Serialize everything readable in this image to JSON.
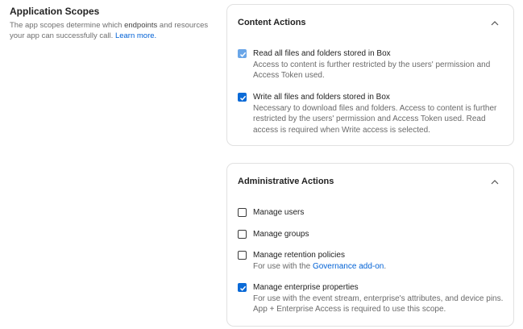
{
  "intro": {
    "title": "Application Scopes",
    "desc_part1": "The app scopes determine which",
    "desc_strong": "endpoints",
    "desc_part2": "and resources your app can successfully call.",
    "learn_more": "Learn more."
  },
  "content_actions": {
    "title": "Content Actions",
    "items": [
      {
        "label": "Read all files and folders stored in Box",
        "desc": "Access to content is further restricted by the users' permission and Access Token used.",
        "checked": true,
        "disabled": true
      },
      {
        "label": "Write all files and folders stored in Box",
        "desc": "Necessary to download files and folders. Access to content is further restricted by the users' permission and Access Token used. Read access is required when Write access is selected.",
        "checked": true,
        "disabled": false
      }
    ]
  },
  "admin_actions": {
    "title": "Administrative Actions",
    "items": [
      {
        "label": "Manage users",
        "checked": false
      },
      {
        "label": "Manage groups",
        "checked": false
      },
      {
        "label": "Manage retention policies",
        "desc_prefix": "For use with the",
        "desc_link": "Governance add-on",
        "desc_suffix": ".",
        "checked": false
      },
      {
        "label": "Manage enterprise properties",
        "desc": "For use with the event stream, enterprise's attributes, and device pins. App + Enterprise Access is required to use this scope.",
        "checked": true
      }
    ]
  },
  "colors": {
    "accent": "#0a6ad7",
    "accent_disabled": "#6aa6e8",
    "link": "#0061d5",
    "border": "#e1e1e1"
  },
  "icons": {
    "collapse": "chevron-up-icon",
    "check": "checkmark-icon"
  }
}
